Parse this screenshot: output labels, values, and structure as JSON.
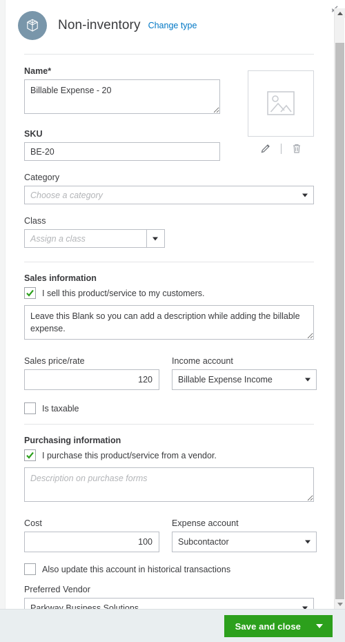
{
  "header": {
    "type_label": "Non-inventory",
    "change_type_link": "Change type",
    "badge_icon": "open-box-icon",
    "close_icon": "close-icon"
  },
  "image": {
    "placeholder_icon": "image-placeholder-icon",
    "edit_icon": "pencil-icon",
    "delete_icon": "trash-icon"
  },
  "fields": {
    "name": {
      "label": "Name*",
      "value": "Billable Expense - 20"
    },
    "sku": {
      "label": "SKU",
      "value": "BE-20"
    },
    "category": {
      "label": "Category",
      "placeholder": "Choose a category",
      "value": ""
    },
    "class": {
      "label": "Class",
      "placeholder": "Assign a class",
      "value": ""
    }
  },
  "sales": {
    "heading": "Sales information",
    "sell_checkbox_label": "I sell this product/service to my customers.",
    "sell_checked": true,
    "description": "Leave this Blank so you can add a description while adding the billable expense.",
    "price_label": "Sales price/rate",
    "price_value": "120",
    "income_account_label": "Income account",
    "income_account_value": "Billable Expense Income",
    "taxable_label": "Is taxable",
    "taxable_checked": false
  },
  "purchasing": {
    "heading": "Purchasing information",
    "purchase_checkbox_label": "I purchase this product/service from a vendor.",
    "purchase_checked": true,
    "description_placeholder": "Description on purchase forms",
    "description_value": "",
    "cost_label": "Cost",
    "cost_value": "100",
    "expense_account_label": "Expense account",
    "expense_account_value": "Subcontactor",
    "historical_label": "Also update this account in historical transactions",
    "historical_checked": false,
    "vendor_label": "Preferred Vendor",
    "vendor_value": "Parkway Business Solutions"
  },
  "footer": {
    "save_label": "Save and close",
    "save_caret_icon": "chevron-down-icon"
  },
  "colors": {
    "accent_green": "#2ca01c",
    "link_blue": "#0077c5",
    "badge_blue": "#7996aa",
    "footer_bg": "#e9eef0"
  }
}
